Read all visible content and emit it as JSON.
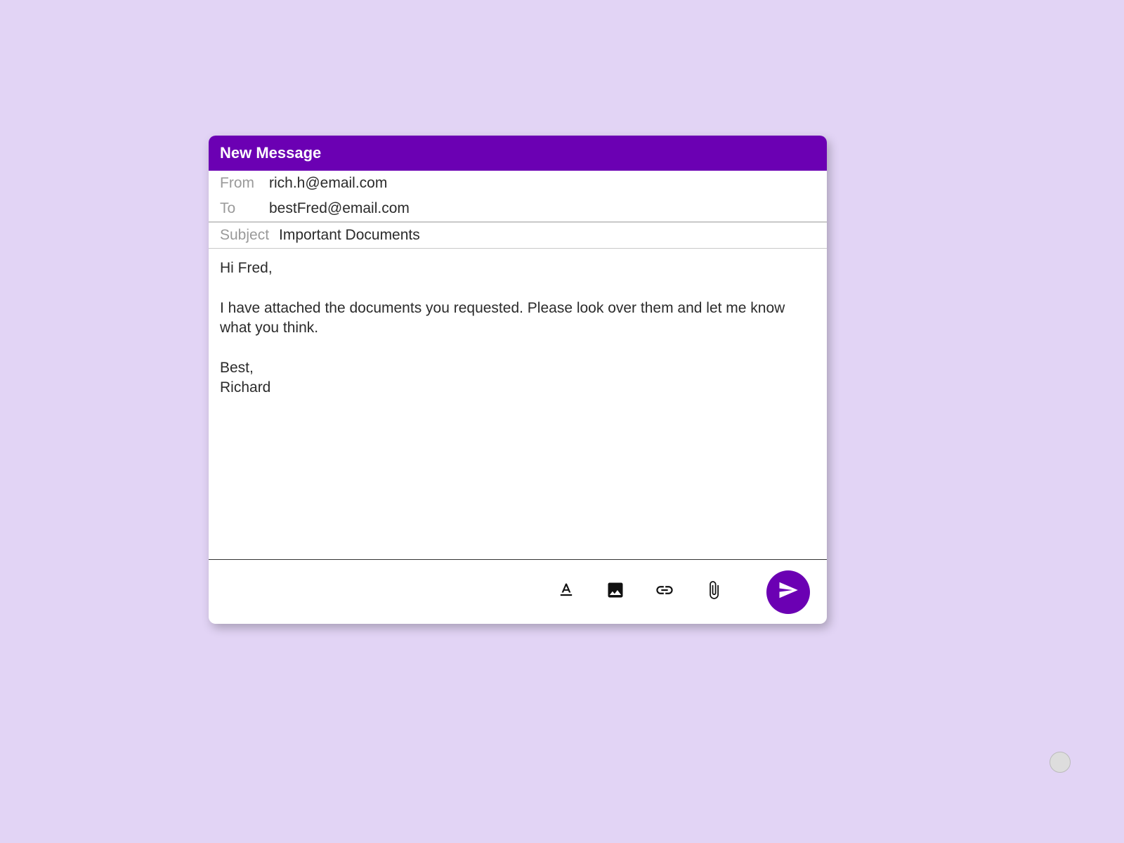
{
  "window": {
    "title": "New Message"
  },
  "fields": {
    "from_label": "From",
    "from_value": "rich.h@email.com",
    "to_label": "To",
    "to_value": "bestFred@email.com",
    "subject_label": "Subject",
    "subject_value": "Important Documents"
  },
  "body": "Hi Fred,\n\nI have attached the documents you requested. Please look over them and let me know what you think.\n\nBest,\nRichard",
  "toolbar": {
    "format_icon": "format",
    "image_icon": "image",
    "link_icon": "link",
    "attach_icon": "attach",
    "send_icon": "send"
  }
}
